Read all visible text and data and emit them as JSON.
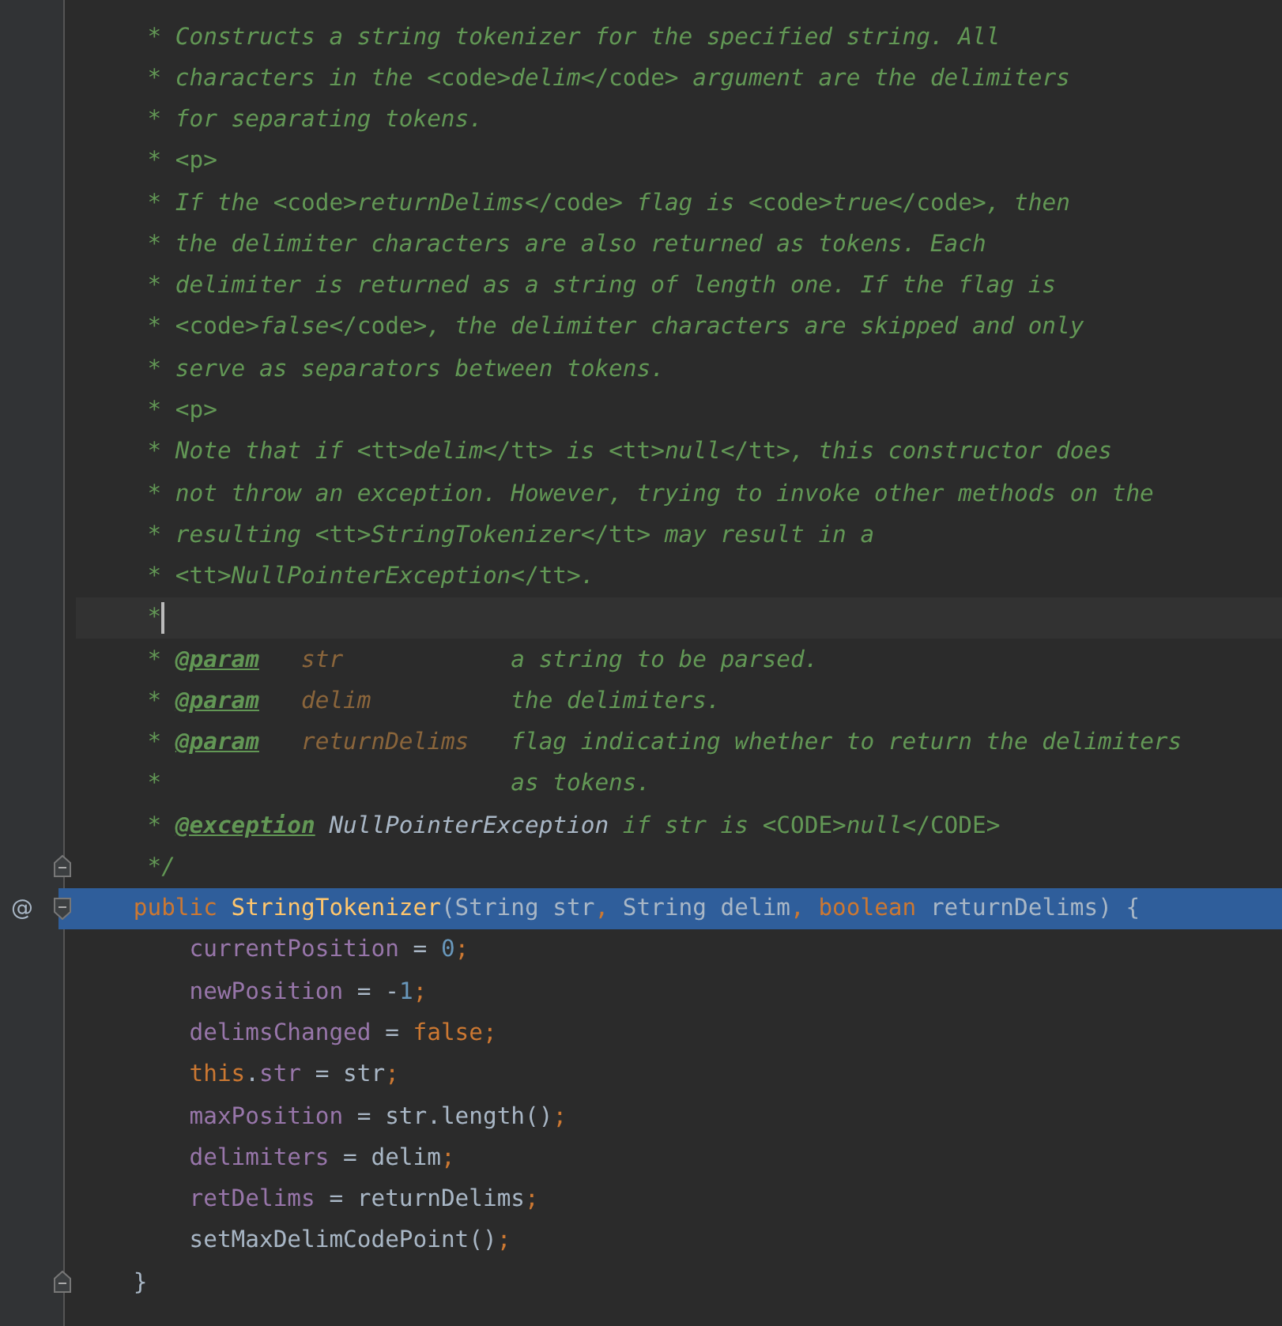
{
  "lines": [
    {
      "kind": "doc",
      "selected": false,
      "current": false,
      "fold_start": false,
      "fold_end": false,
      "tokens": [
        {
          "text": "* Constructs a string tokenizer for the specified string. All",
          "kind": "comment"
        }
      ]
    },
    {
      "kind": "doc",
      "selected": false,
      "current": false,
      "fold_start": false,
      "fold_end": false,
      "tokens": [
        {
          "text": "* characters in the ",
          "kind": "comment"
        },
        {
          "text": "<code>",
          "kind": "html"
        },
        {
          "text": "delim",
          "kind": "comment"
        },
        {
          "text": "</code>",
          "kind": "html"
        },
        {
          "text": " argument are the delimiters",
          "kind": "comment"
        }
      ]
    },
    {
      "kind": "doc",
      "selected": false,
      "current": false,
      "fold_start": false,
      "fold_end": false,
      "tokens": [
        {
          "text": "* for separating tokens.",
          "kind": "comment"
        }
      ]
    },
    {
      "kind": "doc",
      "selected": false,
      "current": false,
      "fold_start": false,
      "fold_end": false,
      "tokens": [
        {
          "text": "* ",
          "kind": "comment"
        },
        {
          "text": "<p>",
          "kind": "html"
        }
      ]
    },
    {
      "kind": "doc",
      "selected": false,
      "current": false,
      "fold_start": false,
      "fold_end": false,
      "tokens": [
        {
          "text": "* If the ",
          "kind": "comment"
        },
        {
          "text": "<code>",
          "kind": "html"
        },
        {
          "text": "returnDelims",
          "kind": "comment"
        },
        {
          "text": "</code>",
          "kind": "html"
        },
        {
          "text": " flag is ",
          "kind": "comment"
        },
        {
          "text": "<code>",
          "kind": "html"
        },
        {
          "text": "true",
          "kind": "comment"
        },
        {
          "text": "</code>",
          "kind": "html"
        },
        {
          "text": ", then",
          "kind": "comment"
        }
      ]
    },
    {
      "kind": "doc",
      "selected": false,
      "current": false,
      "fold_start": false,
      "fold_end": false,
      "tokens": [
        {
          "text": "* the delimiter characters are also returned as tokens. Each",
          "kind": "comment"
        }
      ]
    },
    {
      "kind": "doc",
      "selected": false,
      "current": false,
      "fold_start": false,
      "fold_end": false,
      "tokens": [
        {
          "text": "* delimiter is returned as a string of length one. If the flag is",
          "kind": "comment"
        }
      ]
    },
    {
      "kind": "doc",
      "selected": false,
      "current": false,
      "fold_start": false,
      "fold_end": false,
      "tokens": [
        {
          "text": "* ",
          "kind": "comment"
        },
        {
          "text": "<code>",
          "kind": "html"
        },
        {
          "text": "false",
          "kind": "comment"
        },
        {
          "text": "</code>",
          "kind": "html"
        },
        {
          "text": ", the delimiter characters are skipped and only",
          "kind": "comment"
        }
      ]
    },
    {
      "kind": "doc",
      "selected": false,
      "current": false,
      "fold_start": false,
      "fold_end": false,
      "tokens": [
        {
          "text": "* serve as separators between tokens.",
          "kind": "comment"
        }
      ]
    },
    {
      "kind": "doc",
      "selected": false,
      "current": false,
      "fold_start": false,
      "fold_end": false,
      "tokens": [
        {
          "text": "* ",
          "kind": "comment"
        },
        {
          "text": "<p>",
          "kind": "html"
        }
      ]
    },
    {
      "kind": "doc",
      "selected": false,
      "current": false,
      "fold_start": false,
      "fold_end": false,
      "tokens": [
        {
          "text": "* Note that if ",
          "kind": "comment"
        },
        {
          "text": "<tt>",
          "kind": "html"
        },
        {
          "text": "delim",
          "kind": "comment"
        },
        {
          "text": "</tt>",
          "kind": "html"
        },
        {
          "text": " is ",
          "kind": "comment"
        },
        {
          "text": "<tt>",
          "kind": "html"
        },
        {
          "text": "null",
          "kind": "comment"
        },
        {
          "text": "</tt>",
          "kind": "html"
        },
        {
          "text": ", this constructor does",
          "kind": "comment"
        }
      ]
    },
    {
      "kind": "doc",
      "selected": false,
      "current": false,
      "fold_start": false,
      "fold_end": false,
      "tokens": [
        {
          "text": "* not throw an exception. However, trying to invoke other methods on the",
          "kind": "comment"
        }
      ]
    },
    {
      "kind": "doc",
      "selected": false,
      "current": false,
      "fold_start": false,
      "fold_end": false,
      "tokens": [
        {
          "text": "* resulting ",
          "kind": "comment"
        },
        {
          "text": "<tt>",
          "kind": "html"
        },
        {
          "text": "StringTokenizer",
          "kind": "comment"
        },
        {
          "text": "</tt>",
          "kind": "html"
        },
        {
          "text": " may result in a",
          "kind": "comment"
        }
      ]
    },
    {
      "kind": "doc",
      "selected": false,
      "current": false,
      "fold_start": false,
      "fold_end": false,
      "tokens": [
        {
          "text": "* ",
          "kind": "comment"
        },
        {
          "text": "<tt>",
          "kind": "html"
        },
        {
          "text": "NullPointerException",
          "kind": "comment"
        },
        {
          "text": "</tt>",
          "kind": "html"
        },
        {
          "text": ".",
          "kind": "comment"
        }
      ]
    },
    {
      "kind": "doc",
      "selected": false,
      "current": true,
      "fold_start": false,
      "fold_end": false,
      "tokens": [
        {
          "text": "*",
          "kind": "comment"
        }
      ]
    },
    {
      "kind": "doc",
      "selected": false,
      "current": false,
      "fold_start": false,
      "fold_end": false,
      "tokens": [
        {
          "text": "* ",
          "kind": "comment"
        },
        {
          "text": "@param",
          "kind": "tag"
        },
        {
          "text": "   str",
          "kind": "param"
        },
        {
          "text": "            a string to be parsed.",
          "kind": "comment"
        }
      ]
    },
    {
      "kind": "doc",
      "selected": false,
      "current": false,
      "fold_start": false,
      "fold_end": false,
      "tokens": [
        {
          "text": "* ",
          "kind": "comment"
        },
        {
          "text": "@param",
          "kind": "tag"
        },
        {
          "text": "   delim",
          "kind": "param"
        },
        {
          "text": "          the delimiters.",
          "kind": "comment"
        }
      ]
    },
    {
      "kind": "doc",
      "selected": false,
      "current": false,
      "fold_start": false,
      "fold_end": false,
      "tokens": [
        {
          "text": "* ",
          "kind": "comment"
        },
        {
          "text": "@param",
          "kind": "tag"
        },
        {
          "text": "   returnDelims",
          "kind": "param"
        },
        {
          "text": "   flag indicating whether to return the delimiters",
          "kind": "comment"
        }
      ]
    },
    {
      "kind": "doc",
      "selected": false,
      "current": false,
      "fold_start": false,
      "fold_end": false,
      "tokens": [
        {
          "text": "*                         as tokens.",
          "kind": "comment"
        }
      ]
    },
    {
      "kind": "doc",
      "selected": false,
      "current": false,
      "fold_start": false,
      "fold_end": false,
      "tokens": [
        {
          "text": "* ",
          "kind": "comment"
        },
        {
          "text": "@exception",
          "kind": "tag"
        },
        {
          "text": " NullPointerException",
          "kind": "classref"
        },
        {
          "text": " if str is ",
          "kind": "comment"
        },
        {
          "text": "<CODE>",
          "kind": "html"
        },
        {
          "text": "null",
          "kind": "comment"
        },
        {
          "text": "</CODE>",
          "kind": "html"
        }
      ]
    },
    {
      "kind": "doc",
      "selected": false,
      "current": false,
      "fold_start": false,
      "fold_end": true,
      "tokens": [
        {
          "text": "*/",
          "kind": "comment"
        }
      ]
    },
    {
      "kind": "decl",
      "selected": true,
      "current": false,
      "fold_start": true,
      "fold_end": false,
      "gutter": "@",
      "tokens": [
        {
          "text": "public",
          "kind": "keyword"
        },
        {
          "text": " StringTokenizer",
          "kind": "method"
        },
        {
          "text": "(String str",
          "kind": "plain"
        },
        {
          "text": ",",
          "kind": "punct"
        },
        {
          "text": " String delim",
          "kind": "plain"
        },
        {
          "text": ",",
          "kind": "punct"
        },
        {
          "text": " boolean",
          "kind": "keyword"
        },
        {
          "text": " returnDelims) {",
          "kind": "plain"
        }
      ]
    },
    {
      "kind": "stmt",
      "selected": false,
      "current": false,
      "fold_start": false,
      "fold_end": false,
      "tokens": [
        {
          "text": "currentPosition",
          "kind": "field"
        },
        {
          "text": " = ",
          "kind": "plain"
        },
        {
          "text": "0",
          "kind": "number"
        },
        {
          "text": ";",
          "kind": "punct"
        }
      ]
    },
    {
      "kind": "stmt",
      "selected": false,
      "current": false,
      "fold_start": false,
      "fold_end": false,
      "tokens": [
        {
          "text": "newPosition",
          "kind": "field"
        },
        {
          "text": " = -",
          "kind": "plain"
        },
        {
          "text": "1",
          "kind": "number"
        },
        {
          "text": ";",
          "kind": "punct"
        }
      ]
    },
    {
      "kind": "stmt",
      "selected": false,
      "current": false,
      "fold_start": false,
      "fold_end": false,
      "tokens": [
        {
          "text": "delimsChanged",
          "kind": "field"
        },
        {
          "text": " = ",
          "kind": "plain"
        },
        {
          "text": "false",
          "kind": "keyword"
        },
        {
          "text": ";",
          "kind": "punct"
        }
      ]
    },
    {
      "kind": "stmt",
      "selected": false,
      "current": false,
      "fold_start": false,
      "fold_end": false,
      "tokens": [
        {
          "text": "this",
          "kind": "keyword"
        },
        {
          "text": ".",
          "kind": "plain"
        },
        {
          "text": "str",
          "kind": "field"
        },
        {
          "text": " = str",
          "kind": "plain"
        },
        {
          "text": ";",
          "kind": "punct"
        }
      ]
    },
    {
      "kind": "stmt",
      "selected": false,
      "current": false,
      "fold_start": false,
      "fold_end": false,
      "tokens": [
        {
          "text": "maxPosition",
          "kind": "field"
        },
        {
          "text": " = str.length()",
          "kind": "plain"
        },
        {
          "text": ";",
          "kind": "punct"
        }
      ]
    },
    {
      "kind": "stmt",
      "selected": false,
      "current": false,
      "fold_start": false,
      "fold_end": false,
      "tokens": [
        {
          "text": "delimiters",
          "kind": "field"
        },
        {
          "text": " = delim",
          "kind": "plain"
        },
        {
          "text": ";",
          "kind": "punct"
        }
      ]
    },
    {
      "kind": "stmt",
      "selected": false,
      "current": false,
      "fold_start": false,
      "fold_end": false,
      "tokens": [
        {
          "text": "retDelims",
          "kind": "field"
        },
        {
          "text": " = returnDelims",
          "kind": "plain"
        },
        {
          "text": ";",
          "kind": "punct"
        }
      ]
    },
    {
      "kind": "stmt",
      "selected": false,
      "current": false,
      "fold_start": false,
      "fold_end": false,
      "tokens": [
        {
          "text": "setMaxDelimCodePoint()",
          "kind": "plain"
        },
        {
          "text": ";",
          "kind": "punct"
        }
      ]
    },
    {
      "kind": "decl",
      "selected": false,
      "current": false,
      "fold_start": false,
      "fold_end": true,
      "tokens": [
        {
          "text": "}",
          "kind": "plain"
        }
      ]
    }
  ]
}
